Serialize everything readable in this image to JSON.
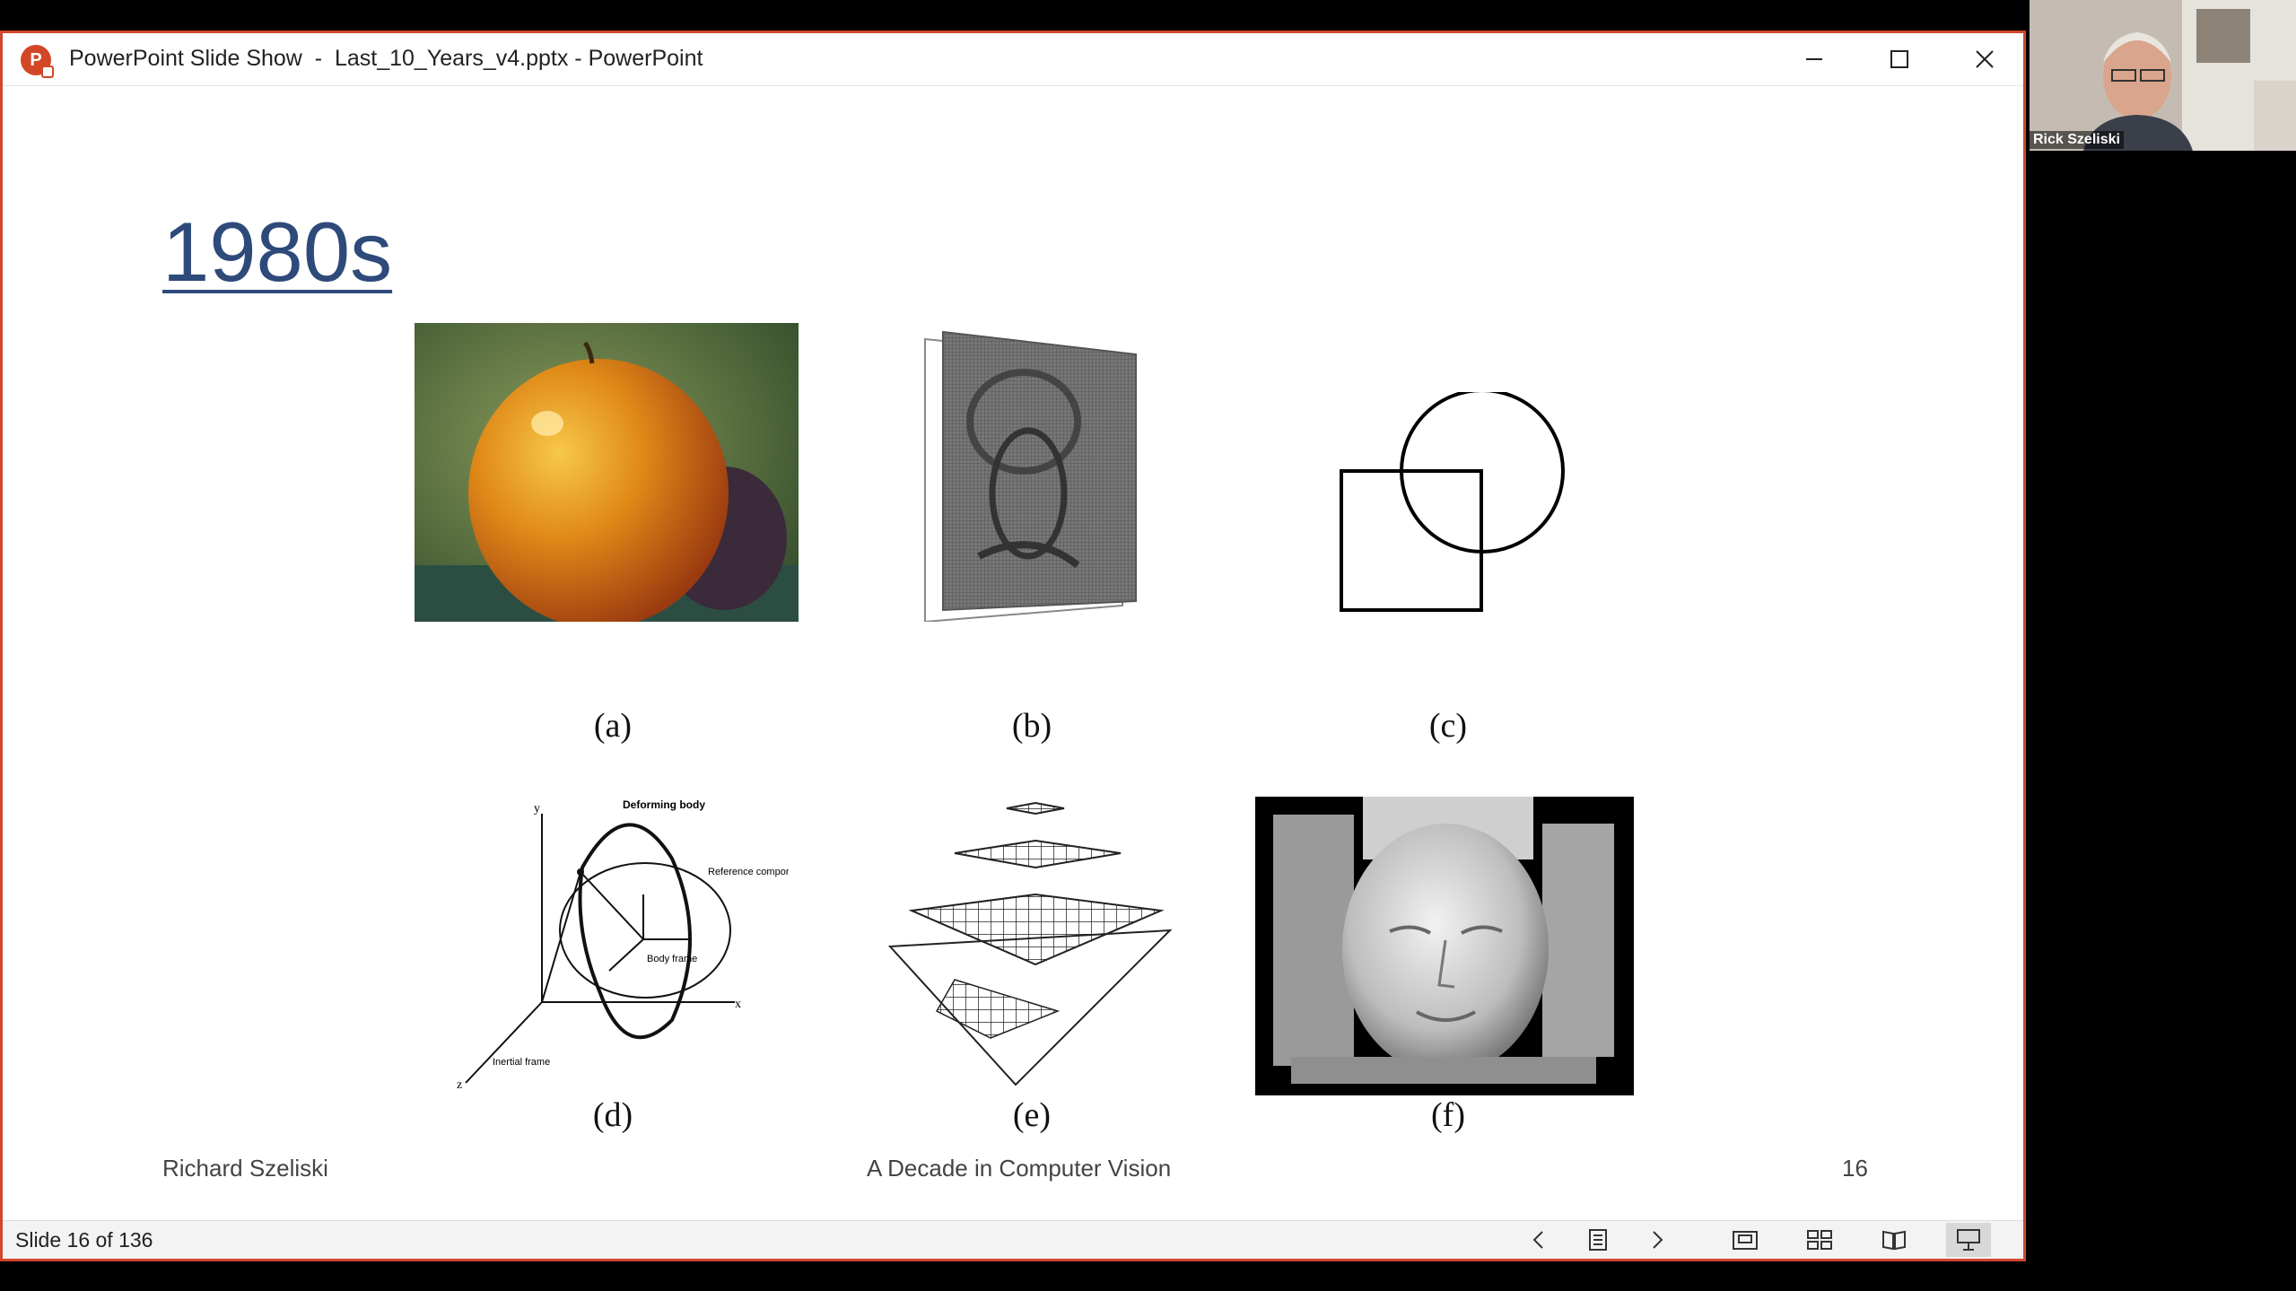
{
  "window": {
    "title": "PowerPoint Slide Show  -  Last_10_Years_v4.pptx - PowerPoint",
    "app_icon_letter": "P",
    "controls": {
      "minimize": "minimize-icon",
      "maximize": "maximize-icon",
      "close": "close-icon"
    }
  },
  "slide": {
    "heading": "1980s",
    "figures": [
      {
        "caption": "(a)",
        "subject": "apple photograph"
      },
      {
        "caption": "(b)",
        "subject": "3D surface relief"
      },
      {
        "caption": "(c)",
        "subject": "square and circle contours"
      },
      {
        "caption": "(d)",
        "subject": "deforming body diagram"
      },
      {
        "caption": "(e)",
        "subject": "multigrid pyramid"
      },
      {
        "caption": "(f)",
        "subject": "3D face reconstruction"
      }
    ],
    "diagram_labels": {
      "deforming_body": "Deforming body",
      "reference_component": "Reference component",
      "body_frame": "Body frame",
      "inertial_frame": "Inertial frame",
      "axis_x": "x",
      "axis_y": "y",
      "axis_z": "z"
    },
    "footer": {
      "author": "Richard Szeliski",
      "talk_title": "A Decade in Computer Vision",
      "page_number": "16"
    }
  },
  "statusbar": {
    "slide_count": "Slide 16 of 136",
    "buttons": [
      "previous-icon",
      "slides-icon",
      "next-icon",
      "normal-view-icon",
      "slide-sorter-icon",
      "reading-view-icon",
      "slide-show-icon"
    ]
  },
  "video": {
    "participant_name": "Rick Szeliski"
  },
  "colors": {
    "window_border": "#d1462f",
    "heading": "#2e4a7a",
    "app_icon": "#d24726"
  }
}
